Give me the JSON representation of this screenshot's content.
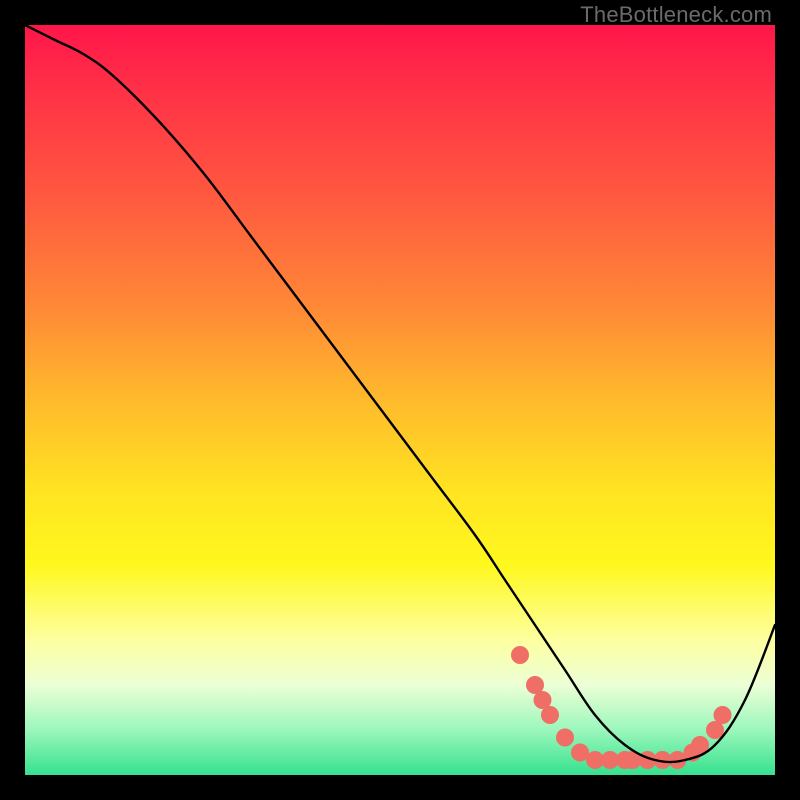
{
  "watermark": {
    "text": "TheBottleneck.com"
  },
  "chart_data": {
    "type": "line",
    "title": "",
    "xlabel": "",
    "ylabel": "",
    "xlim": [
      0,
      100
    ],
    "ylim": [
      0,
      100
    ],
    "grid": false,
    "legend": false,
    "background": "red-to-green vertical gradient",
    "series": [
      {
        "name": "bottleneck-curve",
        "color": "#000000",
        "x": [
          0,
          4,
          8,
          12,
          18,
          24,
          30,
          36,
          42,
          48,
          54,
          60,
          64,
          68,
          72,
          76,
          80,
          84,
          88,
          92,
          96,
          100
        ],
        "y": [
          100,
          98,
          96,
          93,
          87,
          80,
          72,
          64,
          56,
          48,
          40,
          32,
          26,
          20,
          14,
          8,
          4,
          2,
          2,
          4,
          10,
          20
        ]
      }
    ],
    "markers": {
      "name": "bottleneck-range-markers",
      "shape": "circle",
      "color": "#ef6e66",
      "radius_px": 9,
      "points": [
        {
          "x": 66,
          "y": 16
        },
        {
          "x": 68,
          "y": 12
        },
        {
          "x": 69,
          "y": 10
        },
        {
          "x": 70,
          "y": 8
        },
        {
          "x": 72,
          "y": 5
        },
        {
          "x": 74,
          "y": 3
        },
        {
          "x": 76,
          "y": 2
        },
        {
          "x": 78,
          "y": 2
        },
        {
          "x": 80,
          "y": 2
        },
        {
          "x": 81,
          "y": 2
        },
        {
          "x": 83,
          "y": 2
        },
        {
          "x": 85,
          "y": 2
        },
        {
          "x": 87,
          "y": 2
        },
        {
          "x": 89,
          "y": 3
        },
        {
          "x": 90,
          "y": 4
        },
        {
          "x": 92,
          "y": 6
        },
        {
          "x": 93,
          "y": 8
        }
      ]
    }
  }
}
